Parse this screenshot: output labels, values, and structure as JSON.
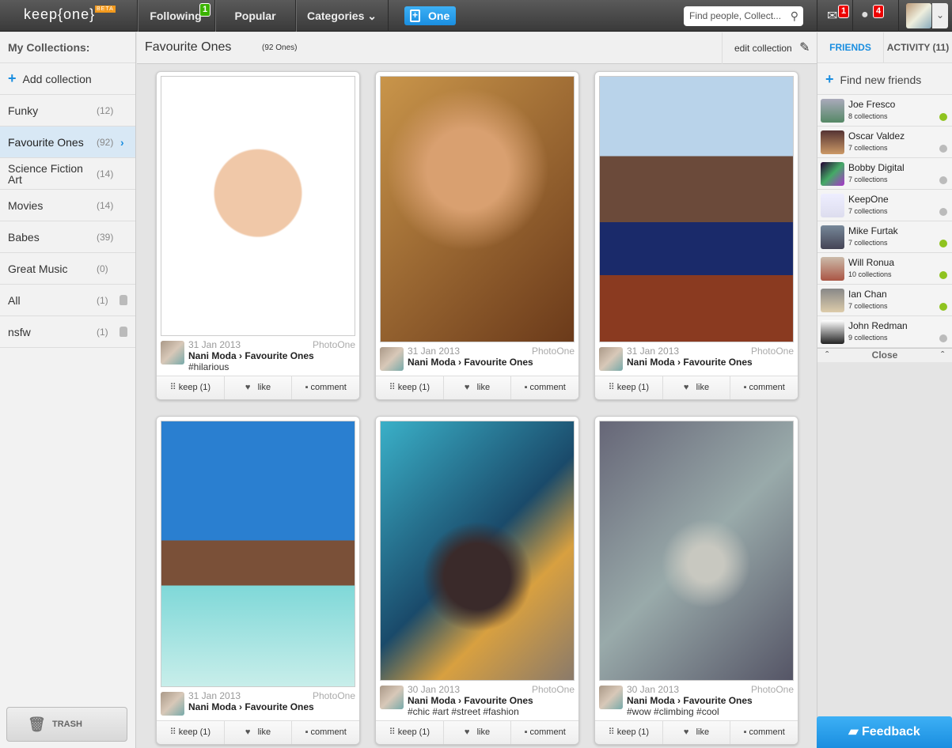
{
  "topbar": {
    "logo": "keep{one}",
    "beta": "BETA",
    "nav": [
      {
        "label": "Following",
        "badge": "1"
      },
      {
        "label": "Popular"
      },
      {
        "label": "Categories"
      }
    ],
    "one_button": "One",
    "search_placeholder": "Find people, Collect...",
    "mail_badge": "1",
    "globe_badge": "4"
  },
  "sidebar": {
    "title": "My Collections:",
    "add": "Add collection",
    "items": [
      {
        "label": "Funky",
        "count": "(12)"
      },
      {
        "label": "Favourite Ones",
        "count": "(92)",
        "active": true
      },
      {
        "label": "Science Fiction Art",
        "count": "(14)"
      },
      {
        "label": "Movies",
        "count": "(14)"
      },
      {
        "label": "Babes",
        "count": "(39)"
      },
      {
        "label": "Great Music",
        "count": "(0)"
      },
      {
        "label": "All",
        "count": "(1)",
        "locked": true
      },
      {
        "label": "nsfw",
        "count": "(1)",
        "locked": true
      }
    ],
    "trash": "TRASH"
  },
  "collection": {
    "title": "Favourite Ones",
    "count": "(92 Ones)",
    "edit": "edit collection"
  },
  "cards": [
    {
      "date": "31 Jan 2013",
      "source": "PhotoOne",
      "user": "Nani Moda",
      "collection": "Favourite Ones",
      "tags": "#hilarious",
      "keep": "keep (1)",
      "like": "like",
      "comment": "comment"
    },
    {
      "date": "31 Jan 2013",
      "source": "PhotoOne",
      "user": "Nani Moda",
      "collection": "Favourite Ones",
      "tags": "",
      "keep": "keep (1)",
      "like": "like",
      "comment": "comment"
    },
    {
      "date": "31 Jan 2013",
      "source": "PhotoOne",
      "user": "Nani Moda",
      "collection": "Favourite Ones",
      "tags": "",
      "keep": "keep (1)",
      "like": "like",
      "comment": "comment"
    },
    {
      "date": "31 Jan 2013",
      "source": "PhotoOne",
      "user": "Nani Moda",
      "collection": "Favourite Ones",
      "tags": "",
      "keep": "keep (1)",
      "like": "like",
      "comment": "comment"
    },
    {
      "date": "30 Jan 2013",
      "source": "PhotoOne",
      "user": "Nani Moda",
      "collection": "Favourite Ones",
      "tags": "#chic #art #street #fashion",
      "keep": "keep (1)",
      "like": "like",
      "comment": "comment"
    },
    {
      "date": "30 Jan 2013",
      "source": "PhotoOne",
      "user": "Nani Moda",
      "collection": "Favourite Ones",
      "tags": "#wow #climbing #cool",
      "keep": "keep (1)",
      "like": "like",
      "comment": "comment"
    }
  ],
  "friends_panel": {
    "tab_friends": "FRIENDS",
    "tab_activity": "ACTIVITY (11)",
    "find": "Find new friends",
    "close": "Close",
    "friends": [
      {
        "name": "Joe Fresco",
        "collections": "8 collections",
        "online": true
      },
      {
        "name": "Oscar Valdez",
        "collections": "7 collections",
        "online": false
      },
      {
        "name": "Bobby Digital",
        "collections": "7 collections",
        "online": false
      },
      {
        "name": "KeepOne",
        "collections": "7 collections",
        "online": false
      },
      {
        "name": "Mike Furtak",
        "collections": "7 collections",
        "online": true
      },
      {
        "name": "Will Ronua",
        "collections": "10 collections",
        "online": true
      },
      {
        "name": "Ian Chan",
        "collections": "7 collections",
        "online": true
      },
      {
        "name": "John Redman",
        "collections": "9 collections",
        "online": false
      }
    ]
  },
  "feedback": "Feedback",
  "colors": {
    "accent": "#1a8ee0",
    "online": "#8fc31f",
    "offline": "#bbbbbb"
  }
}
